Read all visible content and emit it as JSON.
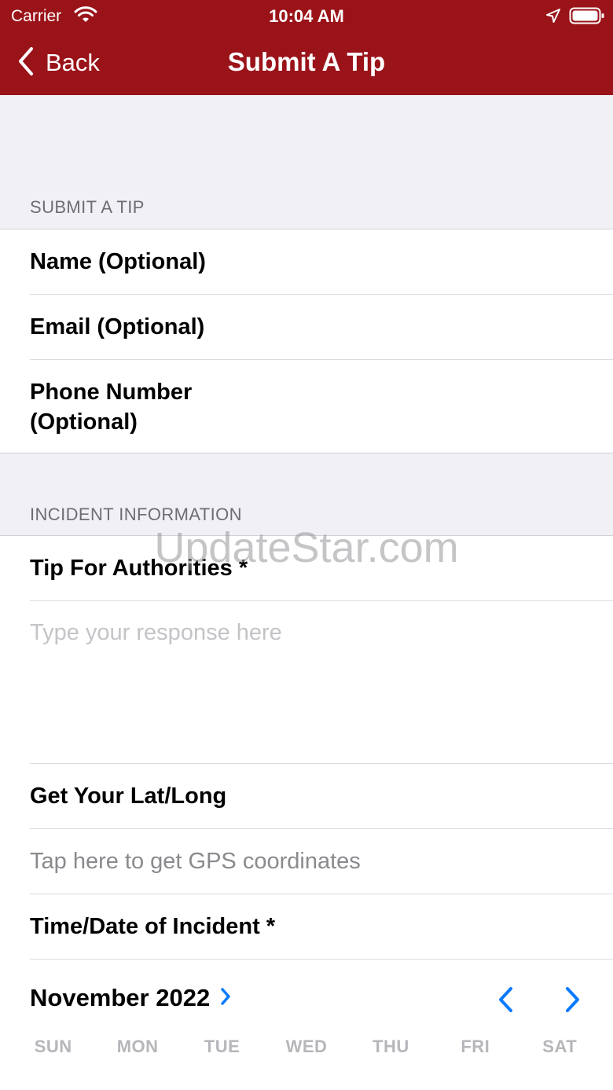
{
  "status_bar": {
    "carrier": "Carrier",
    "time": "10:04 AM"
  },
  "nav": {
    "back_label": "Back",
    "title": "Submit A Tip"
  },
  "sections": {
    "submit": {
      "header": "SUBMIT A TIP",
      "fields": [
        "Name (Optional)",
        "Email (Optional)",
        "Phone Number\n(Optional)"
      ]
    },
    "incident": {
      "header": "INCIDENT INFORMATION",
      "tip_label": "Tip For Authorities *",
      "tip_placeholder": "Type your response here",
      "latlong_label": "Get Your Lat/Long",
      "latlong_action": "Tap here to get GPS coordinates",
      "datetime_label": "Time/Date of Incident *"
    }
  },
  "calendar": {
    "month": "November 2022",
    "weekdays": [
      "SUN",
      "MON",
      "TUE",
      "WED",
      "THU",
      "FRI",
      "SAT"
    ]
  },
  "watermark": "UpdateStar.com",
  "colors": {
    "brand": "#9a1319",
    "accent": "#0a7aff",
    "background": "#f0f0f5"
  },
  "icons": [
    "wifi-icon",
    "location-arrow-icon",
    "battery-icon",
    "chevron-left-icon",
    "chevron-right-icon"
  ]
}
